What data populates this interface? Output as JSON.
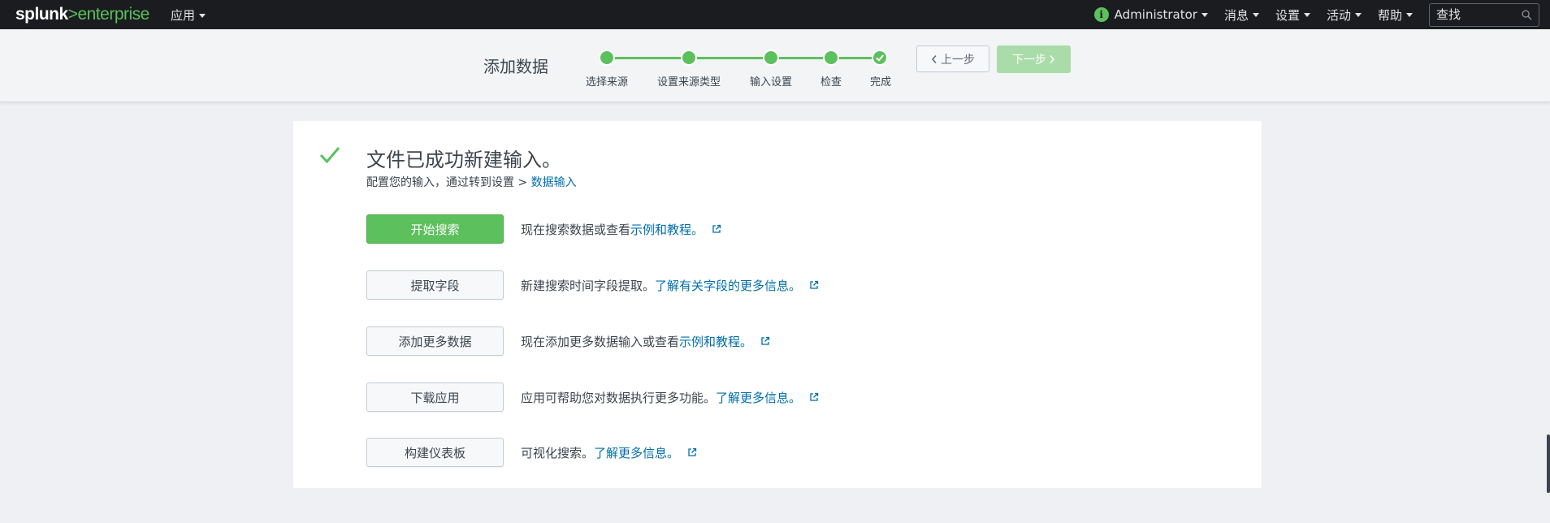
{
  "topbar": {
    "logo_main": "splunk",
    "logo_gt": ">",
    "logo_product": "enterprise",
    "apps_label": "应用",
    "user_label": "Administrator",
    "messages_label": "消息",
    "settings_label": "设置",
    "activity_label": "活动",
    "help_label": "帮助",
    "search_placeholder": "查找",
    "info_icon_glyph": "i"
  },
  "wizard": {
    "title": "添加数据",
    "steps": [
      {
        "label": "选择来源",
        "state": "complete"
      },
      {
        "label": "设置来源类型",
        "state": "complete"
      },
      {
        "label": "输入设置",
        "state": "complete"
      },
      {
        "label": "检查",
        "state": "complete"
      },
      {
        "label": "完成",
        "state": "current-done"
      }
    ],
    "prev_label": "上一步",
    "next_label": "下一步",
    "next_enabled": false
  },
  "panel": {
    "title": "文件已成功新建输入。",
    "subtitle_prefix": "配置您的输入，通过转到设置 > ",
    "subtitle_link": "数据输入",
    "actions": [
      {
        "button": "开始搜索",
        "primary": true,
        "text": "现在搜索数据或查看 ",
        "link": "示例和教程。"
      },
      {
        "button": "提取字段",
        "primary": false,
        "text": "新建搜索时间字段提取。 ",
        "link": "了解有关字段的更多信息。"
      },
      {
        "button": "添加更多数据",
        "primary": false,
        "text": "现在添加更多数据输入或查看 ",
        "link": "示例和教程。"
      },
      {
        "button": "下载应用",
        "primary": false,
        "text": "应用可帮助您对数据执行更多功能。 ",
        "link": "了解更多信息。"
      },
      {
        "button": "构建仪表板",
        "primary": false,
        "text": "可视化搜索。 ",
        "link": "了解更多信息。"
      }
    ]
  },
  "colors": {
    "accent_green": "#5cc05c",
    "link_blue": "#006eaa",
    "topbar_bg": "#1a1c20"
  }
}
